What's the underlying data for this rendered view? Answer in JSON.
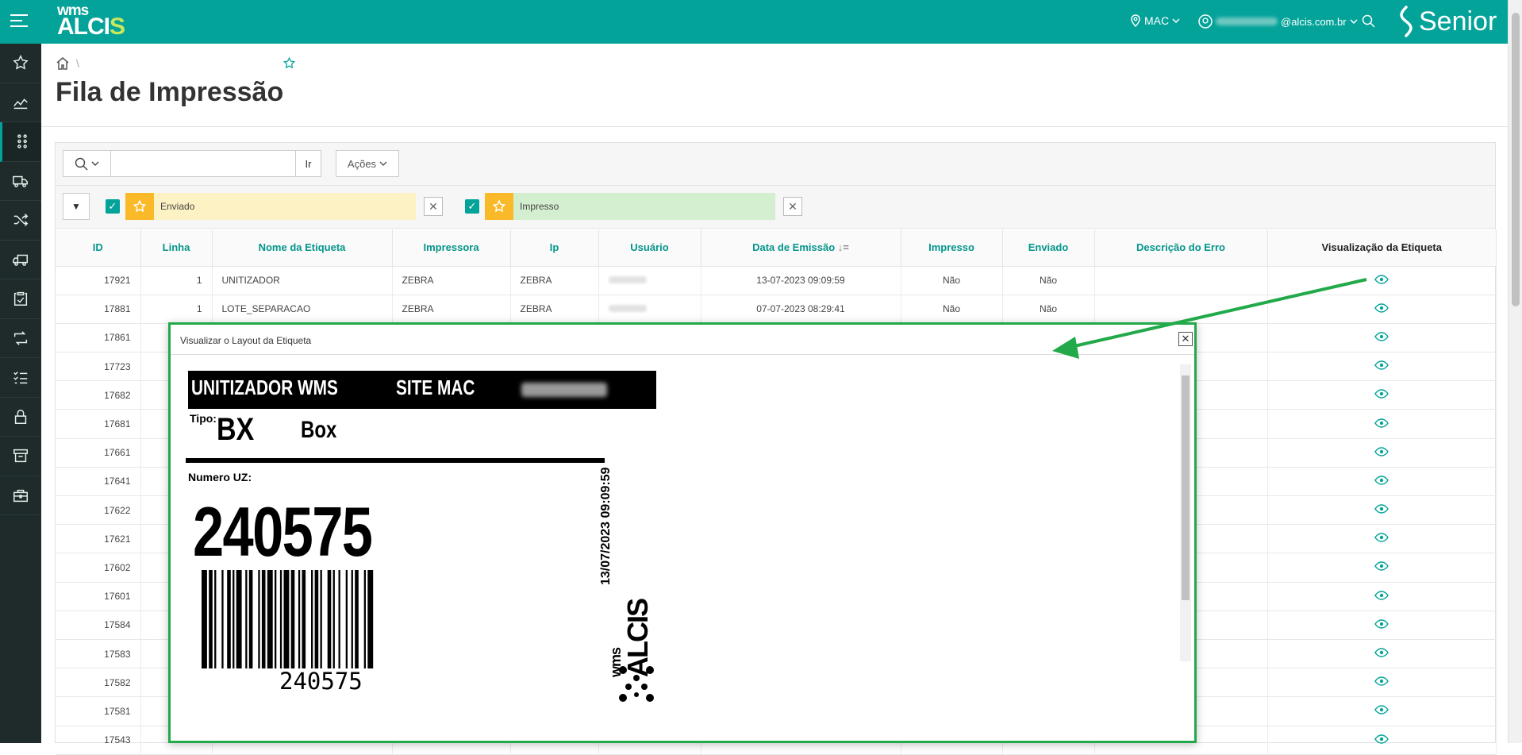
{
  "brand": {
    "wms": "wms",
    "alcis_a": "ALCI",
    "alcis_s": "S",
    "senior": "Senior"
  },
  "topbar": {
    "site": "MAC",
    "user_email": "@alcis.com.br"
  },
  "page": {
    "title": "Fila de Impressão"
  },
  "toolbar": {
    "go_label": "Ir",
    "actions_label": "Ações",
    "search_placeholder": ""
  },
  "filters": [
    {
      "label": "Enviado",
      "color": "#fdf2c4"
    },
    {
      "label": "Impresso",
      "color": "#d4efcf"
    }
  ],
  "table": {
    "columns": [
      "ID",
      "Linha",
      "Nome da Etiqueta",
      "Impressora",
      "Ip",
      "Usuário",
      "Data de Emissão",
      "Impresso",
      "Enviado",
      "Descrição do Erro",
      "Visualização da Etiqueta"
    ],
    "rows": [
      {
        "id": "17921",
        "linha": "1",
        "nome": "UNITIZADOR",
        "impressora": "ZEBRA",
        "ip": "ZEBRA",
        "data": "13-07-2023 09:09:59",
        "impresso": "Não",
        "enviado": "Não"
      },
      {
        "id": "17881",
        "linha": "1",
        "nome": "LOTE_SEPARACAO",
        "impressora": "ZEBRA",
        "ip": "ZEBRA",
        "data": "07-07-2023 08:29:41",
        "impresso": "Não",
        "enviado": "Não"
      },
      {
        "id": "17861"
      },
      {
        "id": "17723"
      },
      {
        "id": "17682"
      },
      {
        "id": "17681"
      },
      {
        "id": "17661"
      },
      {
        "id": "17641"
      },
      {
        "id": "17622"
      },
      {
        "id": "17621"
      },
      {
        "id": "17602"
      },
      {
        "id": "17601"
      },
      {
        "id": "17584"
      },
      {
        "id": "17583"
      },
      {
        "id": "17582"
      },
      {
        "id": "17581"
      },
      {
        "id": "17543"
      }
    ]
  },
  "modal": {
    "title": "Visualizar o Layout da Etiqueta",
    "label": {
      "header_left": "UNITIZADOR WMS",
      "header_site": "SITE  MAC",
      "tipo_label": "Tipo:",
      "tipo_code": "BX",
      "tipo_name": "Box",
      "numero_label": "Numero UZ:",
      "numero": "240575",
      "barcode_text": "240575",
      "date": "13/07/2023 09:09:59",
      "logo_wms": "wms",
      "logo_alcis": "ALCIS"
    }
  },
  "colors": {
    "accent": "#04a39a",
    "sidebar": "#1e2b2a",
    "highlight": "#22a94a",
    "star": "#f9b928"
  }
}
